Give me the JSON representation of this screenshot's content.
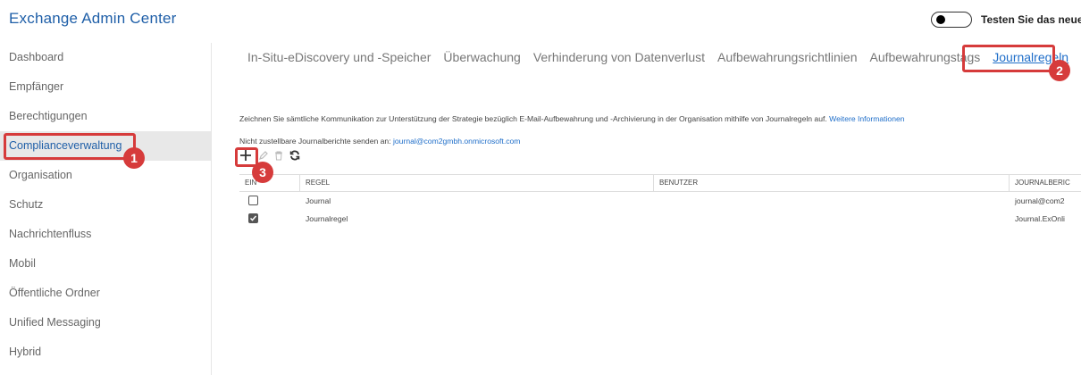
{
  "app": {
    "title": "Exchange Admin Center",
    "toggle_label": "Testen Sie das neue E",
    "accent_color": "#1f6ec9",
    "annotation_color": "#d63b3b"
  },
  "sidebar": {
    "items": [
      {
        "label": "Dashboard"
      },
      {
        "label": "Empfänger"
      },
      {
        "label": "Berechtigungen"
      },
      {
        "label": "Complianceverwaltung"
      },
      {
        "label": "Organisation"
      },
      {
        "label": "Schutz"
      },
      {
        "label": "Nachrichtenfluss"
      },
      {
        "label": "Mobil"
      },
      {
        "label": "Öffentliche Ordner"
      },
      {
        "label": "Unified Messaging"
      },
      {
        "label": "Hybrid"
      }
    ],
    "active": "Complianceverwaltung"
  },
  "tabs": [
    {
      "label": "In-Situ-eDiscovery und -Speicher"
    },
    {
      "label": "Überwachung"
    },
    {
      "label": "Verhinderung von Datenverlust"
    },
    {
      "label": "Aufbewahrungsrichtlinien"
    },
    {
      "label": "Aufbewahrungstags"
    },
    {
      "label": "Journalregeln"
    }
  ],
  "content": {
    "description": "Zeichnen Sie sämtliche Kommunikation zur Unterstützung der Strategie bezüglich E-Mail-Aufbewahrung und -Archivierung in der Organisation mithilfe von Journalregeln auf.",
    "more_info_link": "Weitere Informationen",
    "undeliverable_label": "Nicht zustellbare Journalberichte senden an:",
    "undeliverable_address": "journal@com2gmbh.onmicrosoft.com"
  },
  "toolbar": {
    "icons": [
      "add-icon",
      "edit-icon",
      "delete-icon",
      "refresh-icon"
    ]
  },
  "table": {
    "headers": [
      "EIN",
      "REGEL",
      "BENUTZER",
      "JOURNALBERIC"
    ],
    "rows": [
      {
        "enabled": false,
        "rule": "Journal",
        "user": "",
        "journal": "journal@com2"
      },
      {
        "enabled": true,
        "rule": "Journalregel",
        "user": "",
        "journal": "Journal.ExOnli"
      }
    ]
  },
  "annotations": {
    "badge1": "1",
    "badge2": "2",
    "badge3": "3"
  }
}
